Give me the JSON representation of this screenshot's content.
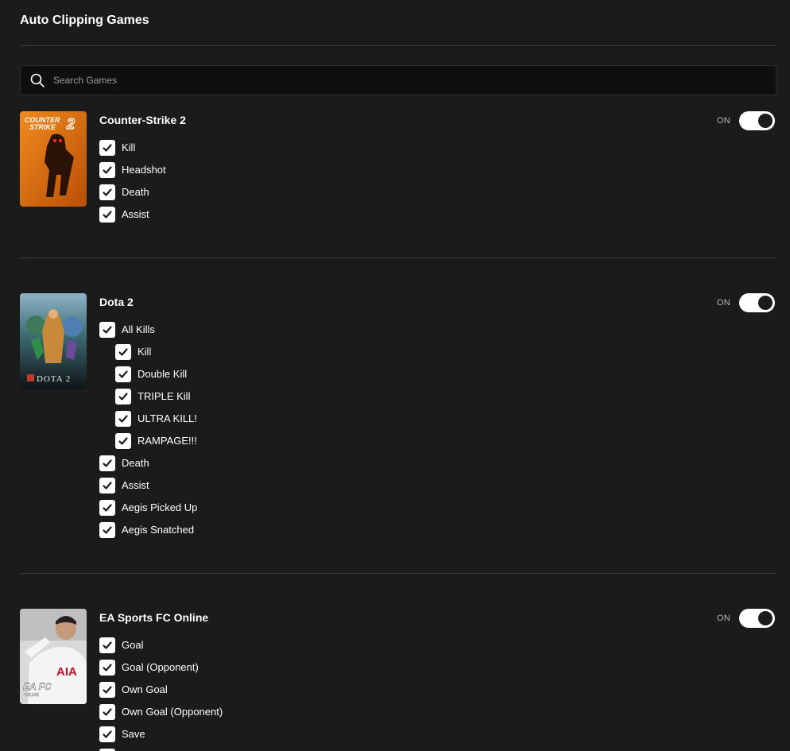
{
  "page_title": "Auto Clipping Games",
  "search": {
    "placeholder": "Search Games"
  },
  "colors": {
    "background": "#1b1b1b",
    "accent": "#ffffff",
    "divider": "#3a3a3a"
  },
  "games": [
    {
      "name": "Counter-Strike 2",
      "cover_text": [
        "COUNTER",
        "STRIKE",
        "2"
      ],
      "toggle": {
        "label": "ON",
        "on": true
      },
      "events": [
        {
          "label": "Kill",
          "checked": true
        },
        {
          "label": "Headshot",
          "checked": true
        },
        {
          "label": "Death",
          "checked": true
        },
        {
          "label": "Assist",
          "checked": true
        }
      ]
    },
    {
      "name": "Dota 2",
      "cover_text": "DOTA 2",
      "toggle": {
        "label": "ON",
        "on": true
      },
      "events": [
        {
          "label": "All Kills",
          "checked": true
        },
        {
          "label": "Kill",
          "checked": true,
          "sub": true
        },
        {
          "label": "Double Kill",
          "checked": true,
          "sub": true
        },
        {
          "label": "TRIPLE Kill",
          "checked": true,
          "sub": true
        },
        {
          "label": "ULTRA KILL!",
          "checked": true,
          "sub": true
        },
        {
          "label": "RAMPAGE!!!",
          "checked": true,
          "sub": true
        },
        {
          "label": "Death",
          "checked": true
        },
        {
          "label": "Assist",
          "checked": true
        },
        {
          "label": "Aegis Picked Up",
          "checked": true
        },
        {
          "label": "Aegis Snatched",
          "checked": true
        }
      ]
    },
    {
      "name": "EA Sports FC Online",
      "cover_text": [
        "EA FC",
        "ONLINE",
        "AIA"
      ],
      "toggle": {
        "label": "ON",
        "on": true
      },
      "events": [
        {
          "label": "Goal",
          "checked": true
        },
        {
          "label": "Goal (Opponent)",
          "checked": true
        },
        {
          "label": "Own Goal",
          "checked": true
        },
        {
          "label": "Own Goal (Opponent)",
          "checked": true
        },
        {
          "label": "Save",
          "checked": true
        }
      ]
    }
  ]
}
